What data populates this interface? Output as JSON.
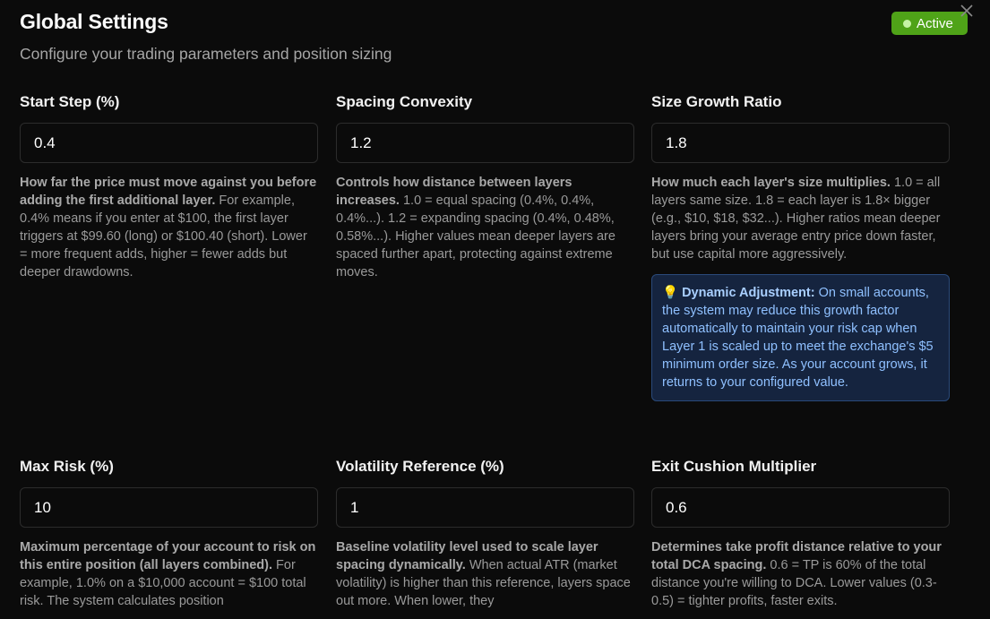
{
  "header": {
    "title": "Global Settings",
    "subtitle": "Configure your trading parameters and position sizing",
    "status_badge": "Active",
    "close_icon": "close-icon"
  },
  "fields": [
    {
      "label": "Start Step (%)",
      "value": "0.4",
      "desc_bold": "How far the price must move against you before adding the first additional layer.",
      "desc_rest": " For example, 0.4% means if you enter at $100, the first layer triggers at $99.60 (long) or $100.40 (short). Lower = more frequent adds, higher = fewer adds but deeper drawdowns."
    },
    {
      "label": "Spacing Convexity",
      "value": "1.2",
      "desc_bold": "Controls how distance between layers increases.",
      "desc_rest": " 1.0 = equal spacing (0.4%, 0.4%, 0.4%...). 1.2 = expanding spacing (0.4%, 0.48%, 0.58%...). Higher values mean deeper layers are spaced further apart, protecting against extreme moves."
    },
    {
      "label": "Size Growth Ratio",
      "value": "1.8",
      "desc_bold": "How much each layer's size multiplies.",
      "desc_rest": " 1.0 = all layers same size. 1.8 = each layer is 1.8× bigger (e.g., $10, $18, $32...). Higher ratios mean deeper layers bring your average entry price down faster, but use capital more aggressively.",
      "info_icon": "lightbulb-icon",
      "info_title": "Dynamic Adjustment:",
      "info_text": " On small accounts, the system may reduce this growth factor automatically to maintain your risk cap when Layer 1 is scaled up to meet the exchange's $5 minimum order size. As your account grows, it returns to your configured value."
    },
    {
      "label": "Max Risk (%)",
      "value": "10",
      "desc_bold": "Maximum percentage of your account to risk on this entire position (all layers combined).",
      "desc_rest": " For example, 1.0% on a $10,000 account = $100 total risk. The system calculates position"
    },
    {
      "label": "Volatility Reference (%)",
      "value": "1",
      "desc_bold": "Baseline volatility level used to scale layer spacing dynamically.",
      "desc_rest": " When actual ATR (market volatility) is higher than this reference, layers space out more. When lower, they"
    },
    {
      "label": "Exit Cushion Multiplier",
      "value": "0.6",
      "desc_bold": "Determines take profit distance relative to your total DCA spacing.",
      "desc_rest": " 0.6 = TP is 60% of the total distance you're willing to DCA. Lower values (0.3-0.5) = tighter profits, faster exits."
    }
  ],
  "colors": {
    "background": "#0b0b0b",
    "badge": "#4fa318",
    "info_bg": "#15243f",
    "info_text": "#8fc0ff"
  }
}
